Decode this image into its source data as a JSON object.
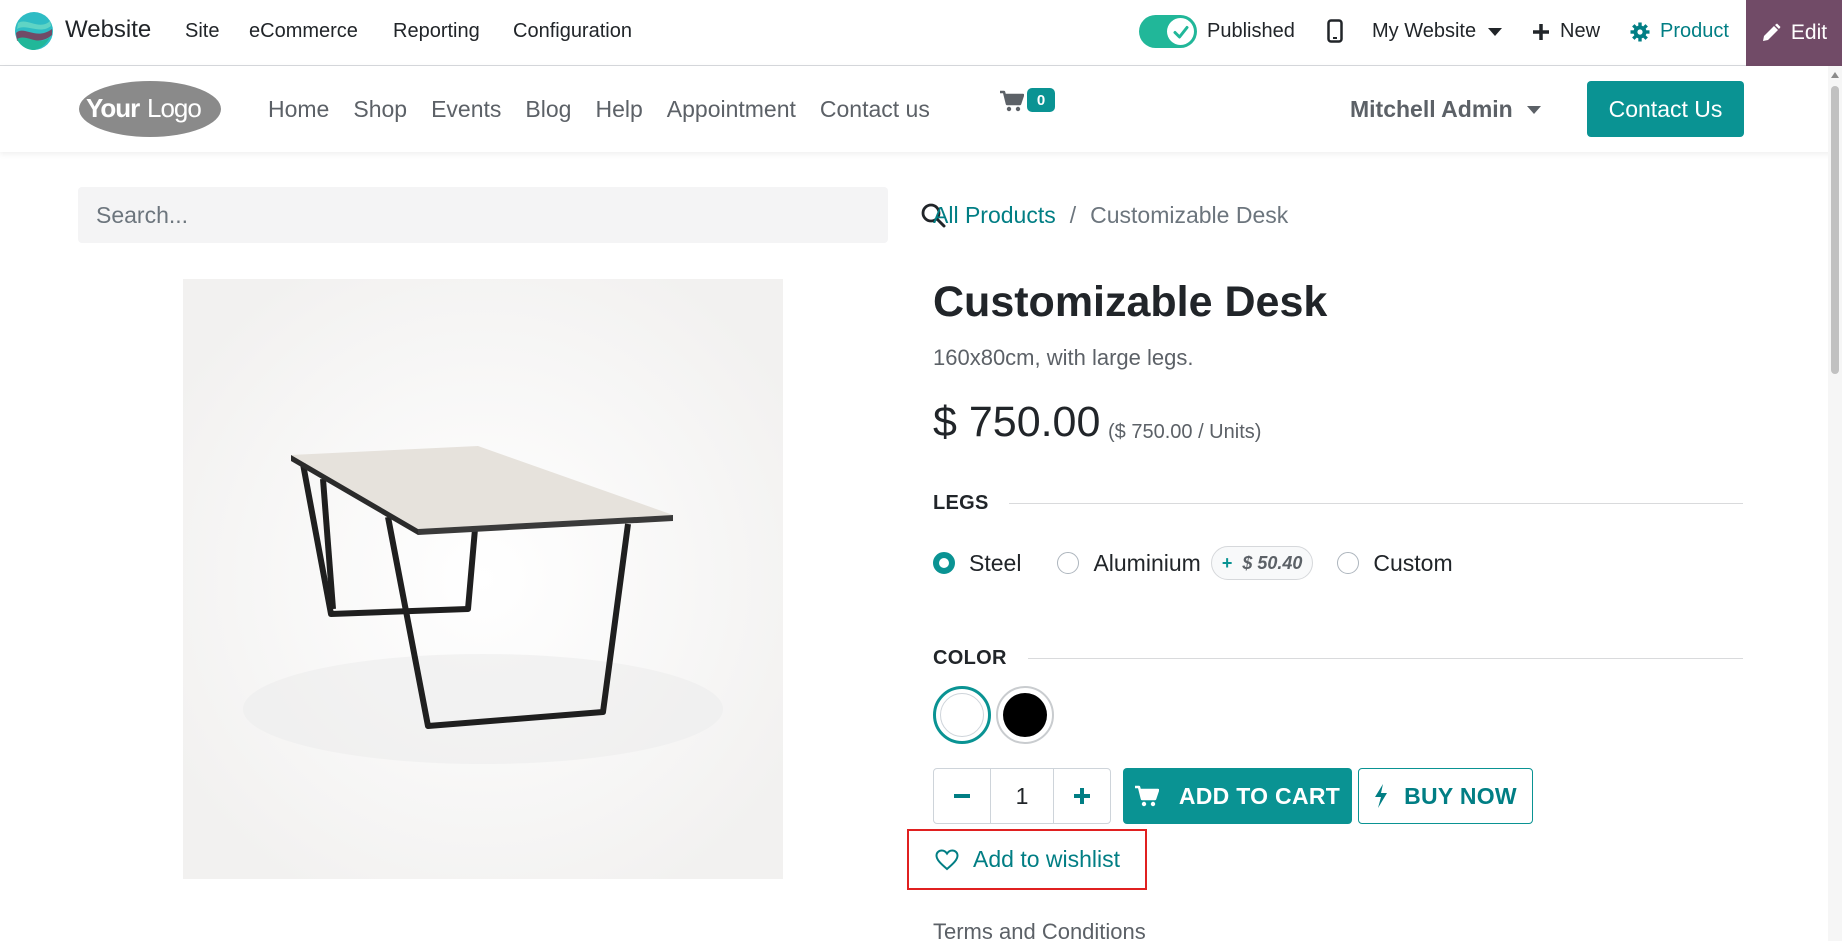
{
  "admin_bar": {
    "app_name": "Website",
    "menu": [
      "Site",
      "eCommerce",
      "Reporting",
      "Configuration"
    ],
    "published_label": "Published",
    "website_selector": "My Website",
    "new_label": "New",
    "product_label": "Product",
    "edit_label": "Edit",
    "accent_color": "#714b67"
  },
  "site_header": {
    "logo_text": "YourLogo",
    "nav": [
      "Home",
      "Shop",
      "Events",
      "Blog",
      "Help",
      "Appointment",
      "Contact us"
    ],
    "cart_count": "0",
    "user_name": "Mitchell Admin",
    "contact_button": "Contact Us",
    "brand_color": "#0a9393"
  },
  "search": {
    "placeholder": "Search..."
  },
  "breadcrumb": {
    "parent": "All Products",
    "separator": "/",
    "current": "Customizable Desk"
  },
  "product": {
    "name": "Customizable Desk",
    "description": "160x80cm, with large legs.",
    "price": "$ 750.00",
    "unit_price": "($ 750.00 / Units)"
  },
  "attributes": {
    "legs": {
      "label": "LEGS",
      "options": [
        {
          "name": "Steel",
          "checked": true,
          "extra": ""
        },
        {
          "name": "Aluminium",
          "checked": false,
          "extra_sign": "+",
          "extra": "$ 50.40"
        },
        {
          "name": "Custom",
          "checked": false,
          "extra": ""
        }
      ]
    },
    "color": {
      "label": "COLOR",
      "options": [
        {
          "name": "White",
          "hex": "#ffffff",
          "selected": true
        },
        {
          "name": "Black",
          "hex": "#000000",
          "selected": false
        }
      ]
    }
  },
  "purchase": {
    "quantity": "1",
    "add_to_cart": "ADD TO CART",
    "buy_now": "BUY NOW",
    "wishlist": "Add to wishlist"
  },
  "footer": {
    "terms": "Terms and Conditions"
  }
}
